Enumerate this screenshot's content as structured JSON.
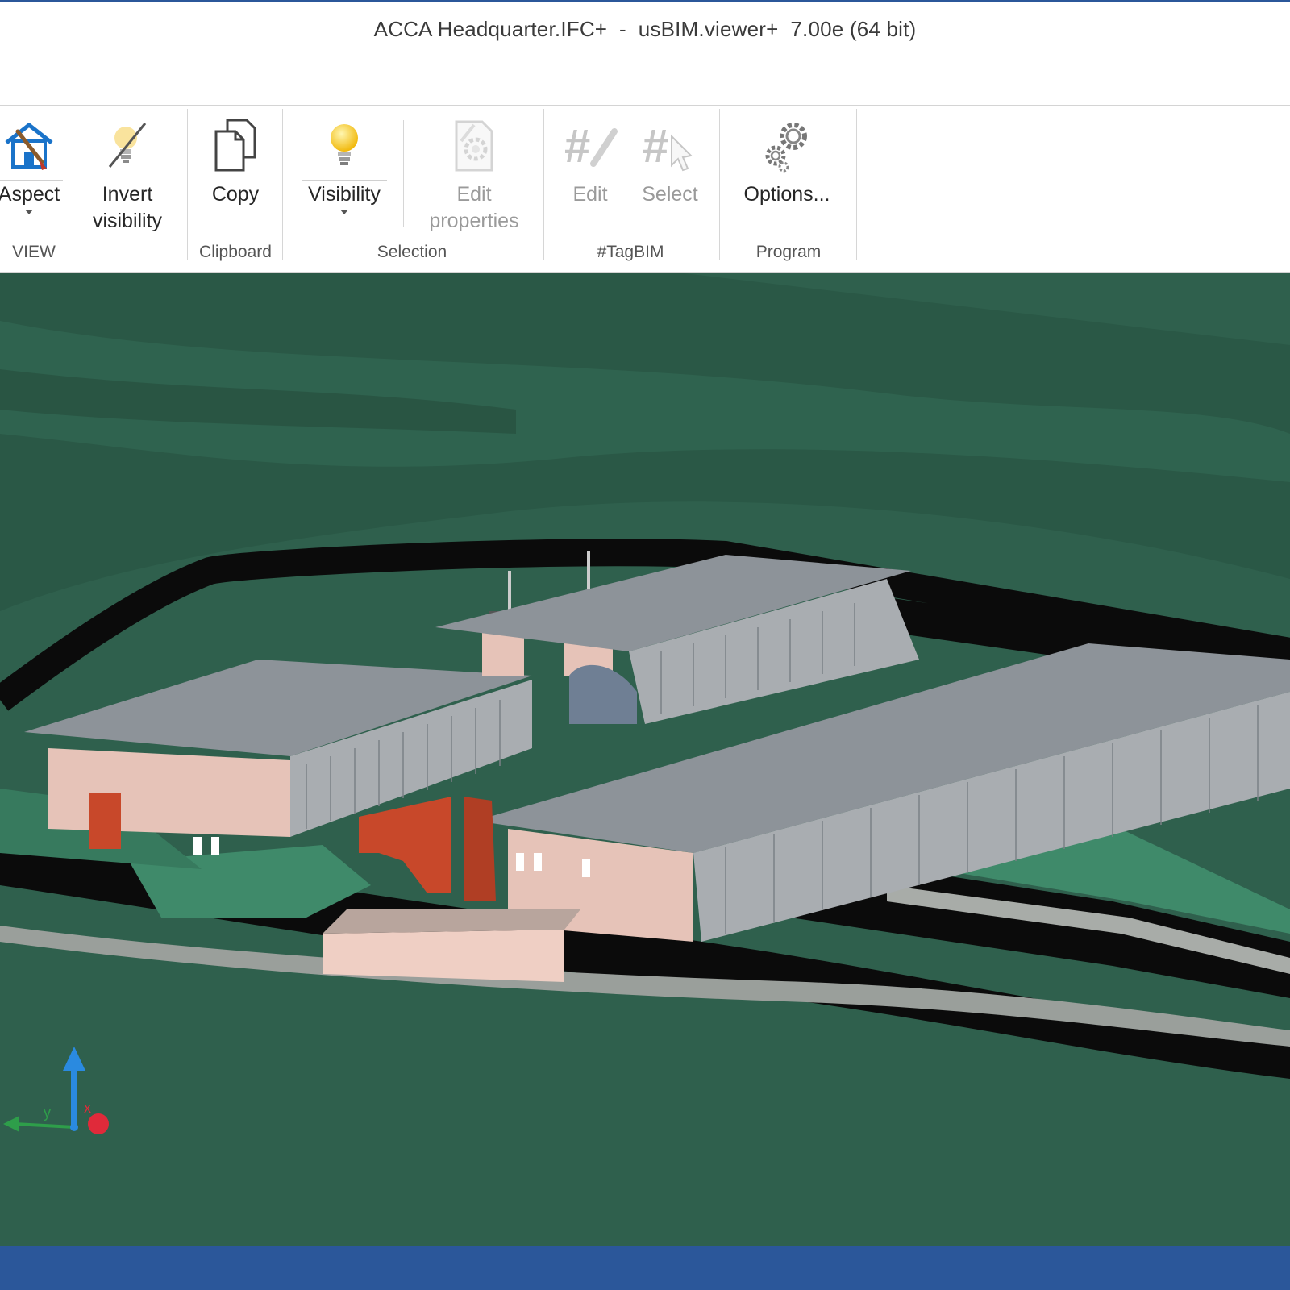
{
  "window": {
    "title": "ACCA Headquarter.IFC+  -  usBIM.viewer+  7.00e (64 bit)"
  },
  "ribbon": {
    "groups": {
      "view": "VIEW",
      "clipboard": "Clipboard",
      "selection": "Selection",
      "tagbim": "#TagBIM",
      "program": "Program"
    },
    "buttons": {
      "aspect": "Aspect",
      "invert_visibility_1": "Invert",
      "invert_visibility_2": "visibility",
      "copy": "Copy",
      "visibility": "Visibility",
      "edit_properties_1": "Edit",
      "edit_properties_2": "properties",
      "tag_edit": "Edit",
      "tag_select": "Select",
      "options": "Options..."
    },
    "icons": {
      "aspect": "house-brush-icon",
      "invert_visibility": "lightbulb-off-icon",
      "copy": "copy-documents-icon",
      "visibility": "lightbulb-on-icon",
      "edit_properties": "document-gear-icon",
      "tag_edit": "hashtag-pencil-icon",
      "tag_select": "hashtag-cursor-icon",
      "options": "gears-icon"
    },
    "disabled": [
      "edit_properties",
      "tag_edit",
      "tag_select"
    ]
  },
  "viewport": {
    "content": "3D BIM model of ACCA Headquarter",
    "axes": {
      "y": "y",
      "x": "x"
    }
  },
  "colors": {
    "accent": "#2b579a",
    "terrain": "#2d5e4b",
    "building_walls": "#e9c9bf",
    "building_roof": "#8a8f96",
    "sculpture": "#c8482a"
  }
}
